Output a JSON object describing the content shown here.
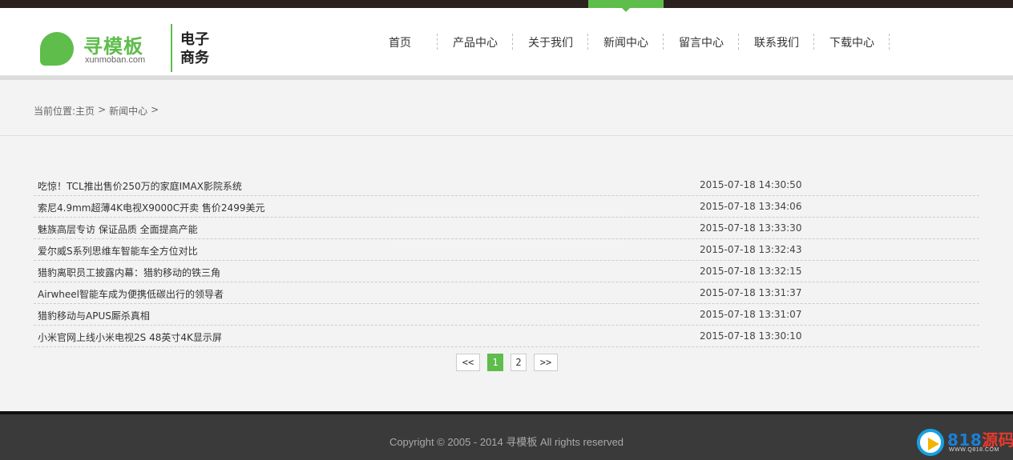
{
  "header": {
    "logo_cn": "寻模板",
    "logo_en": "xunmoban.com",
    "tagline": "电子商务"
  },
  "nav": {
    "items": [
      {
        "label": "首页"
      },
      {
        "label": "产品中心"
      },
      {
        "label": "关于我们"
      },
      {
        "label": "新闻中心"
      },
      {
        "label": "留言中心"
      },
      {
        "label": "联系我们"
      },
      {
        "label": "下载中心"
      }
    ],
    "active_label": "新闻中心"
  },
  "breadcrumb": {
    "prefix": "当前位置:",
    "home": "主页",
    "sep1": ">",
    "current": "新闻中心",
    "sep2": ">"
  },
  "news": {
    "items": [
      {
        "title": "吃惊！TCL推出售价250万的家庭IMAX影院系统",
        "date": "2015-07-18 14:30:50"
      },
      {
        "title": "索尼4.9mm超薄4K电视X9000C开卖 售价2499美元",
        "date": "2015-07-18 13:34:06"
      },
      {
        "title": "魅族高层专访 保证品质 全面提高产能",
        "date": "2015-07-18 13:33:30"
      },
      {
        "title": "爱尔威S系列思维车智能车全方位对比",
        "date": "2015-07-18 13:32:43"
      },
      {
        "title": "猎豹离职员工披露内幕：猎豹移动的铁三角",
        "date": "2015-07-18 13:32:15"
      },
      {
        "title": "Airwheel智能车成为便携低碳出行的领导者",
        "date": "2015-07-18 13:31:37"
      },
      {
        "title": "猎豹移动与APUS厮杀真相",
        "date": "2015-07-18 13:31:07"
      },
      {
        "title": "小米官网上线小米电视2S 48英寸4K显示屏",
        "date": "2015-07-18 13:30:10"
      }
    ]
  },
  "pager": {
    "prev": "<<",
    "pages": [
      "1",
      "2"
    ],
    "current": "1",
    "next": ">>"
  },
  "footer": {
    "copyright": "Copyright © 2005 - 2014 寻模板 All rights reserved"
  },
  "watermark": {
    "num": "818",
    "cn": "源码",
    "url": "WWW.Q818.COM"
  },
  "colors": {
    "accent": "#5ebd4b",
    "topbar": "#2b2220",
    "footer": "#3a3a3a"
  }
}
